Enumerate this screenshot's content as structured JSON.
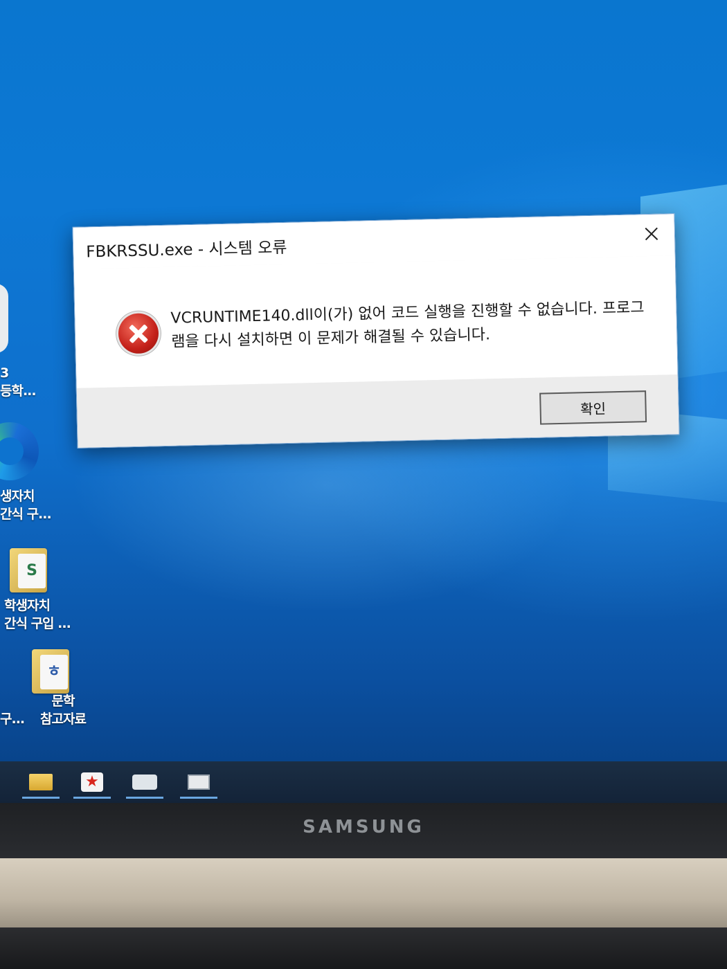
{
  "dialog": {
    "title": "FBKRSSU.exe - 시스템 오류",
    "message": "VCRUNTIME140.dll이(가) 없어 코드 실행을 진행할 수 없습니다. 프로그램을 다시 설치하면 이 문제가 해결될 수 있습니다.",
    "ok_label": "확인",
    "icon": "error-icon"
  },
  "desktop": {
    "items": [
      {
        "line1": "3",
        "line2": "등학..."
      },
      {
        "line1": "생자치",
        "line2": "간식 구..."
      },
      {
        "line1": "학생자치",
        "line2": "간식 구입 ..."
      },
      {
        "line1": "문학",
        "line2": "참고자료"
      }
    ],
    "partial_label": "구..."
  },
  "taskbar": {
    "buttons": [
      "folder-icon",
      "star-app-icon",
      "game-app-icon",
      "media-app-icon"
    ]
  },
  "device": {
    "brand": "SAMSUNG"
  },
  "colors": {
    "desktop_blue": "#0d78d4",
    "error_red": "#c4211a",
    "dialog_bg": "#ffffff"
  }
}
